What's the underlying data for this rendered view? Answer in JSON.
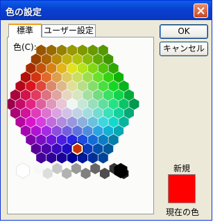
{
  "window": {
    "title": "色の設定",
    "close_icon": "close-icon"
  },
  "tabs": [
    {
      "label": "標準",
      "active": true
    },
    {
      "label": "ユーザー設定",
      "active": false
    }
  ],
  "panel": {
    "color_label": "色(C):",
    "selected_hex": "#cc3300"
  },
  "buttons": {
    "ok": "OK",
    "cancel": "キャンセル"
  },
  "preview": {
    "new_label": "新規",
    "current_label": "現在の色",
    "new_color": "#ff0000"
  },
  "colors": {
    "accent": "#0a3fd0",
    "tab_highlight": "#f0a020"
  }
}
